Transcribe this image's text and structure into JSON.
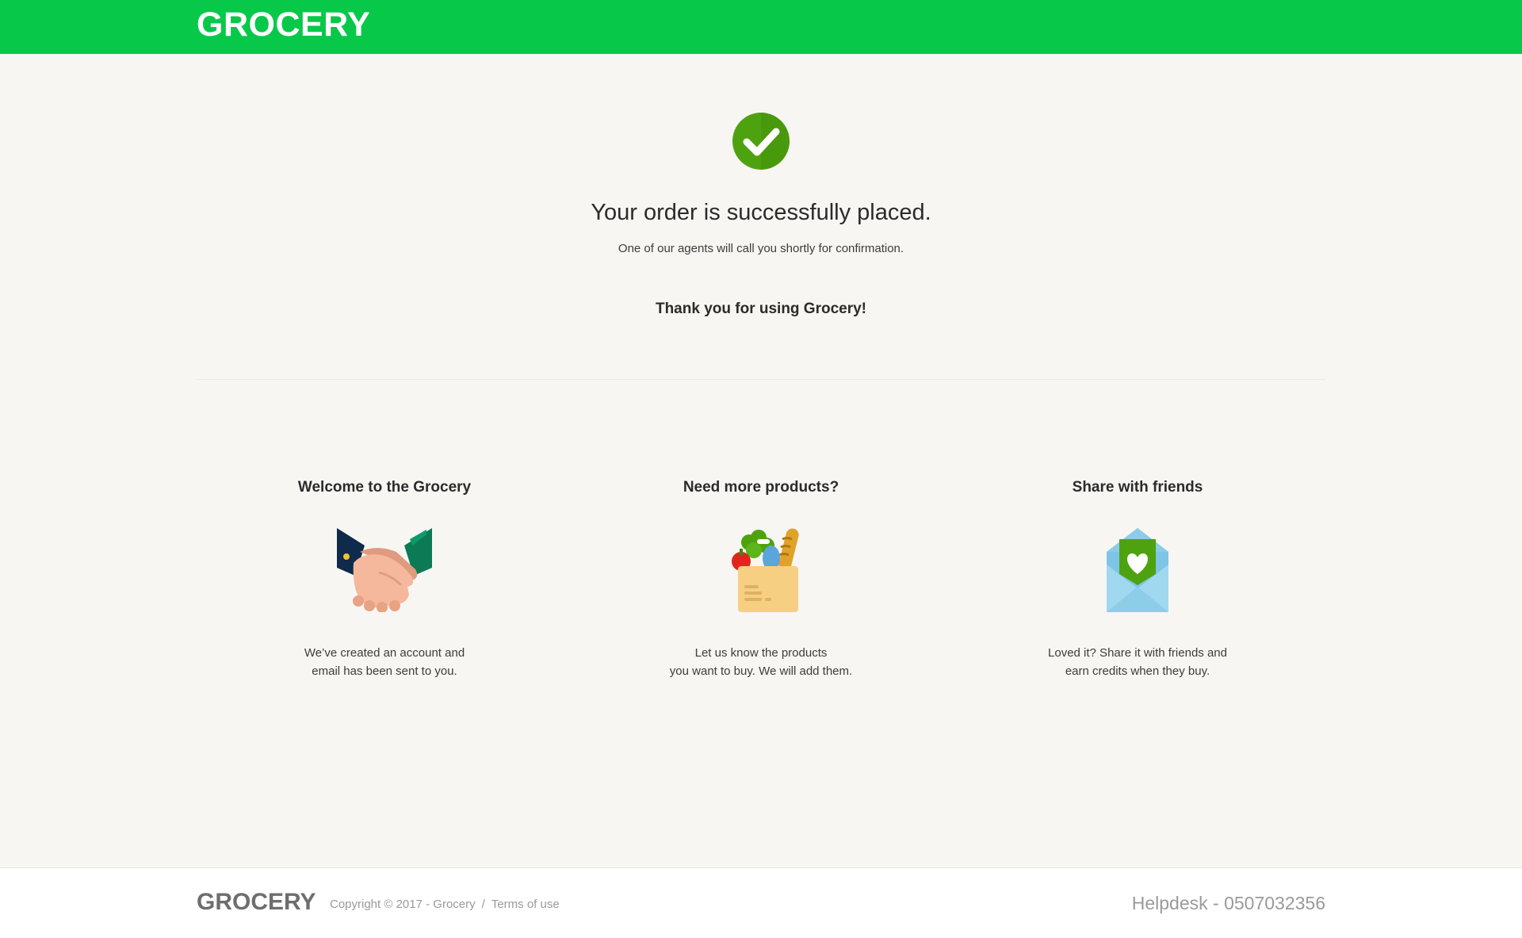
{
  "header": {
    "logo": "GROCERY"
  },
  "confirmation": {
    "title": "Your order is successfully placed.",
    "subtitle": "One of our agents will call you shortly for confirmation.",
    "thanks": "Thank you for using Grocery!"
  },
  "features": [
    {
      "title": "Welcome to the Grocery",
      "icon": "handshake-icon",
      "line1": "We’ve created an account and",
      "line2": "email has been sent to you."
    },
    {
      "title": "Need more products?",
      "icon": "grocery-bag-icon",
      "line1": "Let us know the products",
      "line2": "you want to buy. We will add them."
    },
    {
      "title": "Share with friends",
      "icon": "envelope-heart-icon",
      "line1": "Loved it? Share it with friends and",
      "line2": "earn credits when they buy."
    }
  ],
  "footer": {
    "logo": "GROCERY",
    "copyright": "Copyright © 2017 - Grocery",
    "separator": "/",
    "terms": "Terms of use",
    "helpdesk": "Helpdesk - 0507032356"
  },
  "colors": {
    "brand_green": "#08c84a",
    "check_green": "#4fa20f",
    "background": "#f7f6f3"
  }
}
